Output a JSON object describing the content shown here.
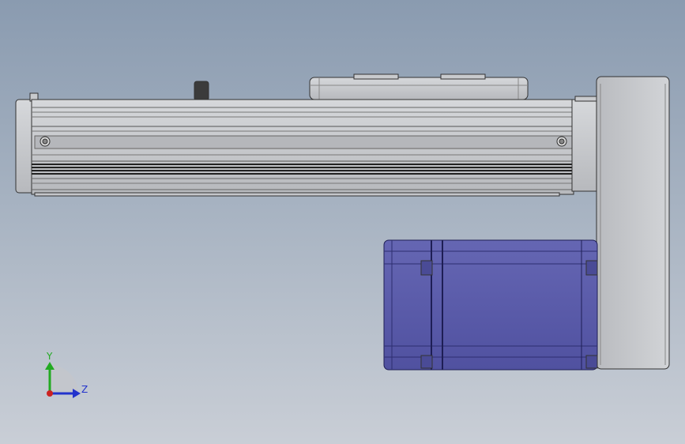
{
  "viewport": {
    "background_top": "#8a9bb0",
    "background_bottom": "#c9ced6"
  },
  "model": {
    "colors": {
      "rail": "#c4c6ca",
      "rail_edge": "#3a3a3a",
      "motor": "#5b5ca8",
      "motor_dark": "#3f4090",
      "housing": "#c9cbce",
      "knob": "#3b3b3b"
    }
  },
  "triad": {
    "y_label": "Y",
    "z_label": "Z",
    "y_color": "#22aa22",
    "z_color": "#2233cc",
    "x_color": "#cc2222"
  }
}
